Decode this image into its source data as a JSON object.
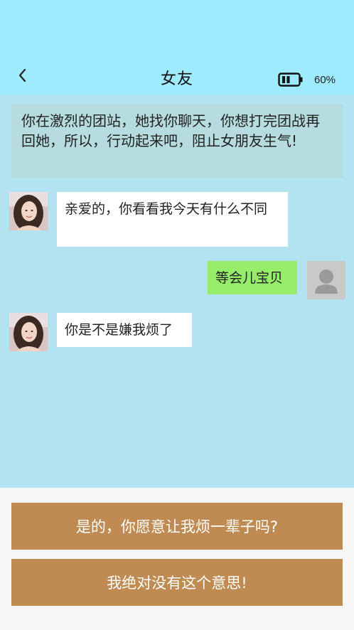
{
  "header": {
    "title": "女友",
    "battery_percent": "60%",
    "battery_level": 0.6,
    "back_icon": "chevron-left-icon",
    "battery_icon": "battery-icon"
  },
  "scenario": {
    "text": "你在激烈的团站，她找你聊天，你想打完团战再回她，所以，行动起来吧，阻止女朋友生气!"
  },
  "messages": [
    {
      "from": "girlfriend",
      "text": "亲爱的，你看看我今天有什么不同"
    },
    {
      "from": "me",
      "text": "等会儿宝贝"
    },
    {
      "from": "girlfriend",
      "text": "你是不是嫌我烦了"
    }
  ],
  "choices": [
    {
      "label": "是的，你愿意让我烦一辈子吗?"
    },
    {
      "label": "我绝对没有这个意思!"
    }
  ],
  "colors": {
    "header_bg": "#9eebfd",
    "chat_bg": "#b3e3f0",
    "scenario_bg": "#b6dcdf",
    "my_bubble": "#97ec6a",
    "their_bubble": "#ffffff",
    "choice_button": "#c08b53",
    "footer_bg": "#f6f6f6"
  }
}
